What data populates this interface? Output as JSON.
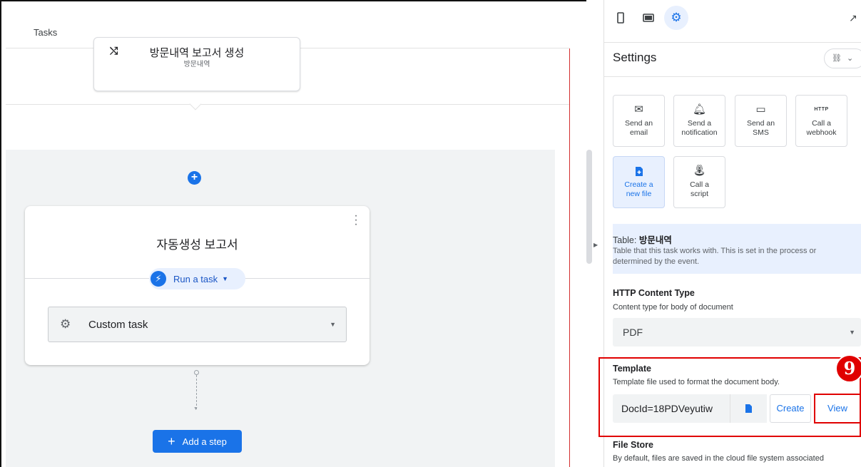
{
  "editor": {
    "header_title": "Tasks",
    "top_card": {
      "title": "방문내역 보고서 생성",
      "subtitle": "방문내역"
    },
    "step_card": {
      "title": "자동생성 보고서",
      "run_chip_label": "Run a task",
      "task_select_value": "Custom task"
    },
    "add_step_label": "Add a step"
  },
  "panel": {
    "settings_title": "Settings",
    "actions": [
      {
        "label_line1": "Send an",
        "label_line2": "email",
        "icon": "mail-icon"
      },
      {
        "label_line1": "Send a",
        "label_line2": "notification",
        "icon": "bell-icon"
      },
      {
        "label_line1": "Send an",
        "label_line2": "SMS",
        "icon": "chat-icon"
      },
      {
        "label_line1": "Call a",
        "label_line2": "webhook",
        "icon": "HTTP"
      },
      {
        "label_line1": "Create a",
        "label_line2": "new file",
        "icon": "file-add-icon"
      },
      {
        "label_line1": "Call a",
        "label_line2": "script",
        "icon": "script-icon"
      }
    ],
    "table_info": {
      "prefix": "Table: ",
      "table_name": "방문내역",
      "description": "Table that this task works with. This is set in the process or determined by the event."
    },
    "http_content_type": {
      "title": "HTTP Content Type",
      "description": "Content type for body of document",
      "value": "PDF"
    },
    "template": {
      "title": "Template",
      "description": "Template file used to format the document body.",
      "value": "DocId=18PDVeyutiw",
      "create_label": "Create",
      "view_label": "View"
    },
    "file_store": {
      "title": "File Store",
      "description": "By default, files are saved in the cloud file system associated"
    }
  },
  "annotation": {
    "step_number": "9"
  },
  "colors": {
    "accent": "#1a73e8",
    "highlight": "#e00000",
    "chip_bg": "#e8f0fe"
  }
}
